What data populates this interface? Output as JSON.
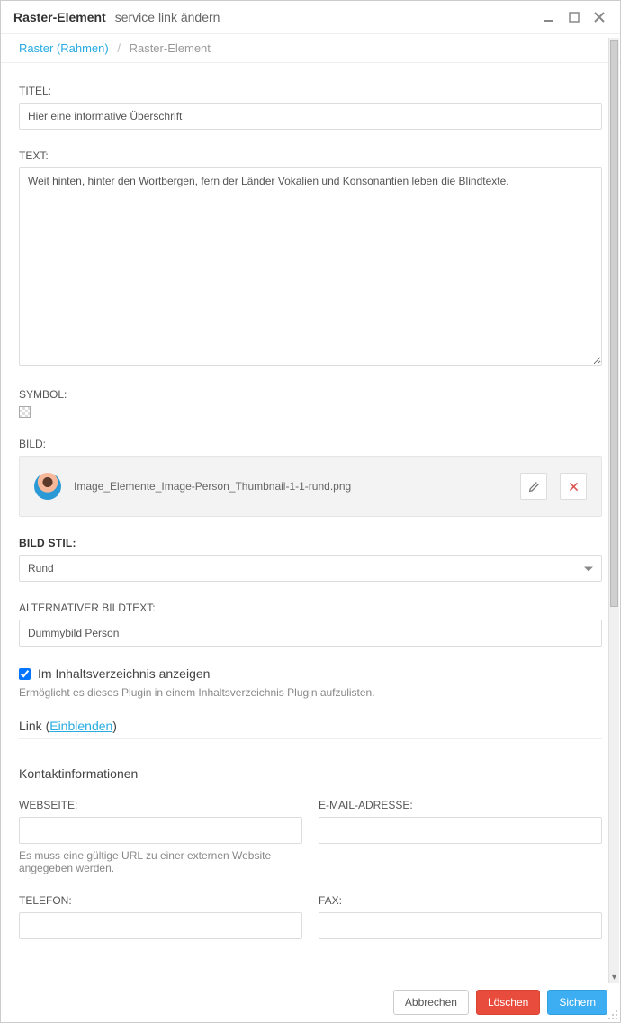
{
  "titlebar": {
    "title": "Raster-Element",
    "subtitle": "service link ändern"
  },
  "breadcrumb": {
    "parent": "Raster (Rahmen)",
    "current": "Raster-Element"
  },
  "labels": {
    "titel": "TITEL:",
    "text": "TEXT:",
    "symbol": "SYMBOL:",
    "bild": "BILD:",
    "bild_stil": "BILD STIL:",
    "alt_text": "ALTERNATIVER BILDTEXT:",
    "webseite": "WEBSEITE:",
    "email": "E-MAIL-ADRESSE:",
    "telefon": "TELEFON:",
    "fax": "FAX:"
  },
  "fields": {
    "titel": "Hier eine informative Überschrift",
    "text": "Weit hinten, hinter den Wortbergen, fern der Länder Vokalien und Konsonantien leben die Blindtexte.",
    "image_filename": "Image_Elemente_Image-Person_Thumbnail-1-1-rund.png",
    "bild_stil": "Rund",
    "alt_text": "Dummybild Person",
    "toc_checked": true,
    "toc_label": "Im Inhaltsverzeichnis anzeigen",
    "toc_help": "Ermöglicht es dieses Plugin in einem Inhaltsverzeichnis Plugin aufzulisten.",
    "webseite": "",
    "email": "",
    "telefon": "",
    "fax": ""
  },
  "link_section": {
    "prefix": "Link (",
    "action": "Einblenden",
    "suffix": ")"
  },
  "contact_heading": "Kontaktinformationen",
  "webseite_help": "Es muss eine gültige URL zu einer externen Website angegeben werden.",
  "buttons": {
    "cancel": "Abbrechen",
    "delete": "Löschen",
    "save": "Sichern"
  }
}
